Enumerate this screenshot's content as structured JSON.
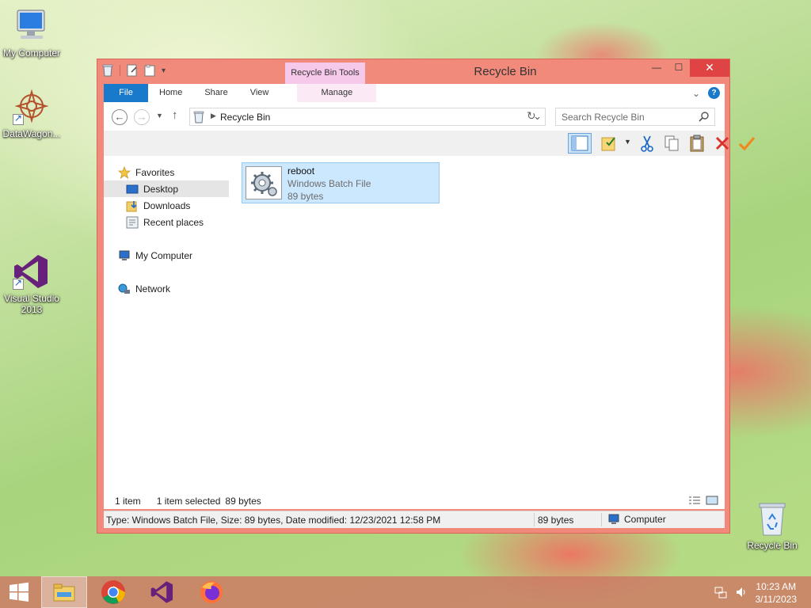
{
  "desktop": {
    "icons": [
      {
        "label": "My Computer"
      },
      {
        "label": "DataWagon..."
      },
      {
        "label": "Visual Studio 2013"
      },
      {
        "label": "Recycle Bin"
      }
    ]
  },
  "window": {
    "title": "Recycle Bin",
    "context_tab": "Recycle Bin Tools",
    "ribbon_tabs": {
      "file": "File",
      "home": "Home",
      "share": "Share",
      "view": "View",
      "manage": "Manage"
    },
    "help_glyph": "?",
    "address": {
      "location": "Recycle Bin"
    },
    "search": {
      "placeholder": "Search Recycle Bin"
    },
    "nav": {
      "favorites": "Favorites",
      "desktop": "Desktop",
      "downloads": "Downloads",
      "recent": "Recent places",
      "computer": "My Computer",
      "network": "Network"
    },
    "files": [
      {
        "name": "reboot",
        "type": "Windows Batch File",
        "size": "89 bytes"
      }
    ],
    "status": {
      "count": "1 item",
      "selected": "1 item selected",
      "selected_size": "89 bytes"
    },
    "details_bar": {
      "info": "Type: Windows Batch File, Size: 89 bytes, Date modified: 12/23/2021 12:58 PM",
      "size": "89 bytes",
      "zone": "Computer"
    }
  },
  "taskbar": {
    "clock": {
      "time": "10:23 AM",
      "date": "3/11/2023"
    }
  },
  "colors": {
    "window_frame": "#f28a7c",
    "close_button": "#e04343",
    "file_tab": "#1979ca",
    "context_tab": "#f6c9ea",
    "selection": "#cce8ff"
  }
}
